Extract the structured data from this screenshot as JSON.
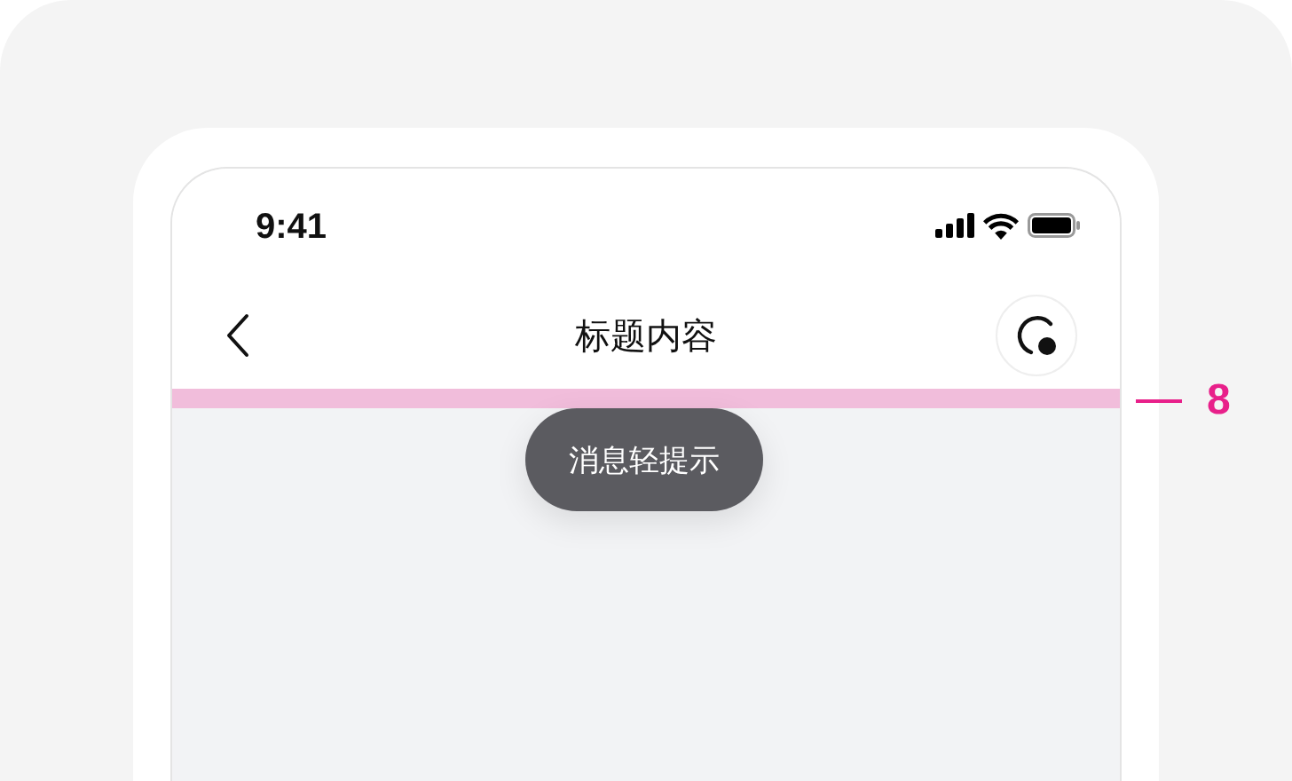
{
  "status_bar": {
    "time": "9:41"
  },
  "nav_bar": {
    "title": "标题内容"
  },
  "spacing_annotation": {
    "value": "8"
  },
  "toast": {
    "text": "消息轻提示"
  }
}
